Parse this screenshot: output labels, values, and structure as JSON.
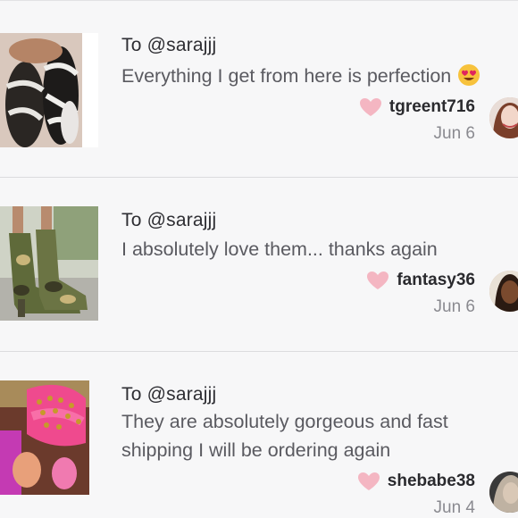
{
  "reviews": [
    {
      "to": "To @sarajjj",
      "comment": "Everything I get from here is perfection",
      "emoji": "heart-eyes-emoji",
      "author": "tgreent716",
      "date": "Jun 6",
      "product_image": "sandals-rhinestone-thumbnail",
      "avatar": "user-avatar"
    },
    {
      "to": "To @sarajjj",
      "comment": "I absolutely love them... thanks again",
      "author": "fantasy36",
      "date": "Jun 6",
      "product_image": "camo-boots-thumbnail",
      "avatar": "user-avatar"
    },
    {
      "to": "To @sarajjj",
      "comment": "They are absolutely gorgeous and fast shipping I will be ordering again",
      "author": "shebabe38",
      "date": "Jun 4",
      "product_image": "pink-studded-sandals-thumbnail",
      "avatar": "user-avatar"
    }
  ],
  "colors": {
    "heart": "#f4b6c2",
    "text_primary": "#2e2e33",
    "text_secondary": "#5a5a60",
    "date": "#8a8a90",
    "divider": "#dcdcde",
    "background": "#f7f7f8"
  }
}
